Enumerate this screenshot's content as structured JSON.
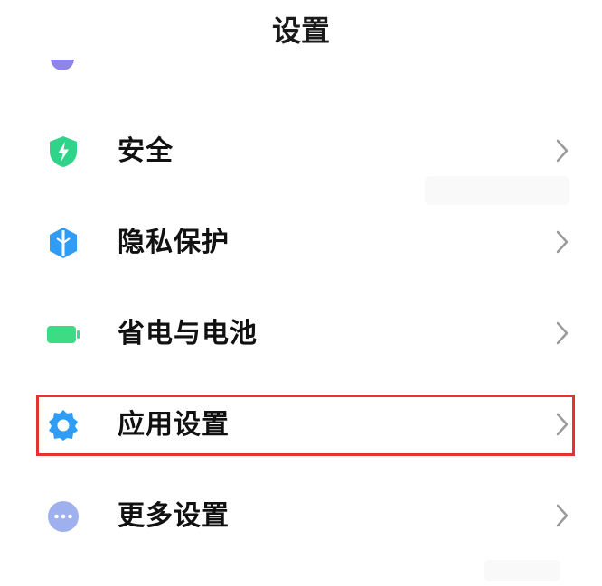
{
  "header": {
    "title": "设置"
  },
  "settings": {
    "items": [
      {
        "label": "安全",
        "icon": "shield-bolt-icon",
        "color": "#2fd48a"
      },
      {
        "label": "隐私保护",
        "icon": "privacy-shield-icon",
        "color": "#2f9cf5"
      },
      {
        "label": "省电与电池",
        "icon": "battery-icon",
        "color": "#3ddc84"
      },
      {
        "label": "应用设置",
        "icon": "gear-icon",
        "color": "#2f9cf5",
        "highlighted": true
      },
      {
        "label": "更多设置",
        "icon": "more-dots-icon",
        "color": "#9fb0ee"
      }
    ]
  },
  "colors": {
    "highlight_border": "#e3342f",
    "chevron": "#9a9a9a"
  }
}
